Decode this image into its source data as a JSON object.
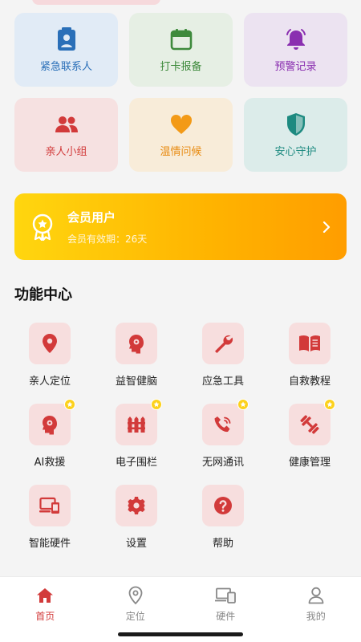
{
  "quick_actions": [
    {
      "label": "紧急联系人",
      "icon": "contact-card-icon",
      "color": "#2a6fb8"
    },
    {
      "label": "打卡报备",
      "icon": "calendar-icon",
      "color": "#3e8a3c"
    },
    {
      "label": "预警记录",
      "icon": "alarm-bell-icon",
      "color": "#8a2fb0"
    },
    {
      "label": "亲人小组",
      "icon": "group-icon",
      "color": "#d23a3a"
    },
    {
      "label": "温情问候",
      "icon": "heart-icon",
      "color": "#e88b12"
    },
    {
      "label": "安心守护",
      "icon": "shield-icon",
      "color": "#1d8a80"
    }
  ],
  "membership": {
    "title": "会员用户",
    "subtitle": "会员有效期：26天"
  },
  "function_center": {
    "title": "功能中心",
    "items": [
      {
        "label": "亲人定位",
        "icon": "location-pin-icon",
        "vip": false
      },
      {
        "label": "益智健脑",
        "icon": "brain-icon",
        "vip": false
      },
      {
        "label": "应急工具",
        "icon": "wrench-icon",
        "vip": false
      },
      {
        "label": "自救教程",
        "icon": "book-icon",
        "vip": false
      },
      {
        "label": "AI救援",
        "icon": "ai-rescue-icon",
        "vip": true
      },
      {
        "label": "电子围栏",
        "icon": "fence-icon",
        "vip": true
      },
      {
        "label": "无网通讯",
        "icon": "phone-call-icon",
        "vip": true
      },
      {
        "label": "健康管理",
        "icon": "dumbbell-icon",
        "vip": true
      },
      {
        "label": "智能硬件",
        "icon": "devices-icon",
        "vip": false
      },
      {
        "label": "设置",
        "icon": "gear-icon",
        "vip": false
      },
      {
        "label": "帮助",
        "icon": "help-icon",
        "vip": false
      }
    ]
  },
  "tabbar": {
    "items": [
      {
        "label": "首页",
        "icon": "home-icon",
        "active": true
      },
      {
        "label": "定位",
        "icon": "location-icon",
        "active": false
      },
      {
        "label": "硬件",
        "icon": "devices-icon",
        "active": false
      },
      {
        "label": "我的",
        "icon": "profile-icon",
        "active": false
      }
    ]
  },
  "colors": {
    "accent_red": "#d23a3a",
    "icon_tile_bg": "#f7dede",
    "member_gradient_start": "#ffd60f",
    "member_gradient_end": "#ff9d00",
    "vip_star": "#fcd11c"
  }
}
